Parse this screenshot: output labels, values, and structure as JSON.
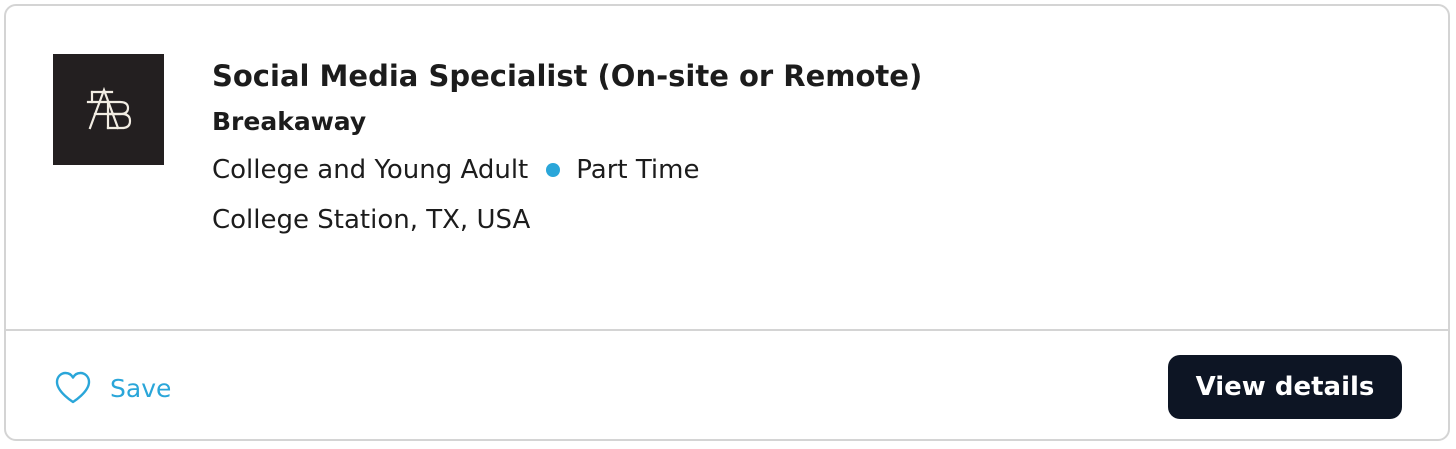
{
  "job": {
    "title": "Social Media Specialist (On-site or Remote)",
    "company": "Breakaway",
    "category": "College and Young Adult",
    "employment_type": "Part Time",
    "location": "College Station, TX, USA",
    "logo_icon": "breakaway-ab-monogram-logo"
  },
  "actions": {
    "save_label": "Save",
    "save_icon": "heart-outline-icon",
    "view_details_label": "View details"
  },
  "colors": {
    "accent": "#2aa6d9",
    "button_bg": "#0d1524",
    "text": "#1c1c1c",
    "logo_bg": "#231f20",
    "border": "#d4d4d4"
  }
}
